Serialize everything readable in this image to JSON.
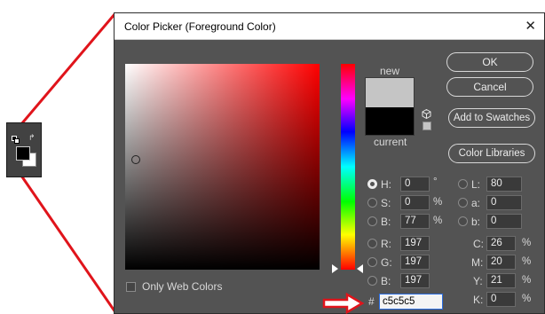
{
  "dialog": {
    "title": "Color Picker (Foreground Color)",
    "close_glyph": "✕"
  },
  "buttons": {
    "ok": "OK",
    "cancel": "Cancel",
    "add_to_swatches": "Add to Swatches",
    "color_libraries": "Color Libraries"
  },
  "preview": {
    "new_label": "new",
    "current_label": "current",
    "new_color": "#c5c5c5",
    "current_color": "#000000"
  },
  "hsb": {
    "h": {
      "label": "H:",
      "value": "0",
      "unit": "°",
      "selected": true
    },
    "s": {
      "label": "S:",
      "value": "0",
      "unit": "%",
      "selected": false
    },
    "b": {
      "label": "B:",
      "value": "77",
      "unit": "%",
      "selected": false
    }
  },
  "rgb": {
    "r": {
      "label": "R:",
      "value": "197"
    },
    "g": {
      "label": "G:",
      "value": "197"
    },
    "b": {
      "label": "B:",
      "value": "197"
    }
  },
  "lab": {
    "l": {
      "label": "L:",
      "value": "80"
    },
    "a": {
      "label": "a:",
      "value": "0"
    },
    "b": {
      "label": "b:",
      "value": "0"
    }
  },
  "cmyk": {
    "c": {
      "label": "C:",
      "value": "26",
      "unit": "%"
    },
    "m": {
      "label": "M:",
      "value": "20",
      "unit": "%"
    },
    "y": {
      "label": "Y:",
      "value": "21",
      "unit": "%"
    },
    "k": {
      "label": "K:",
      "value": "0",
      "unit": "%"
    }
  },
  "hex": {
    "hash": "#",
    "value": "c5c5c5"
  },
  "only_web_colors": {
    "label": "Only Web Colors",
    "checked": false
  },
  "colors": {
    "dialog_bg": "#535353",
    "annotation_red": "#e0141b",
    "field_hue": "#ff0000"
  },
  "icons": {
    "swap": "swap-arrows-icon",
    "cube": "out-of-gamut-cube-icon",
    "pointer": "red-outline-arrow-icon"
  }
}
